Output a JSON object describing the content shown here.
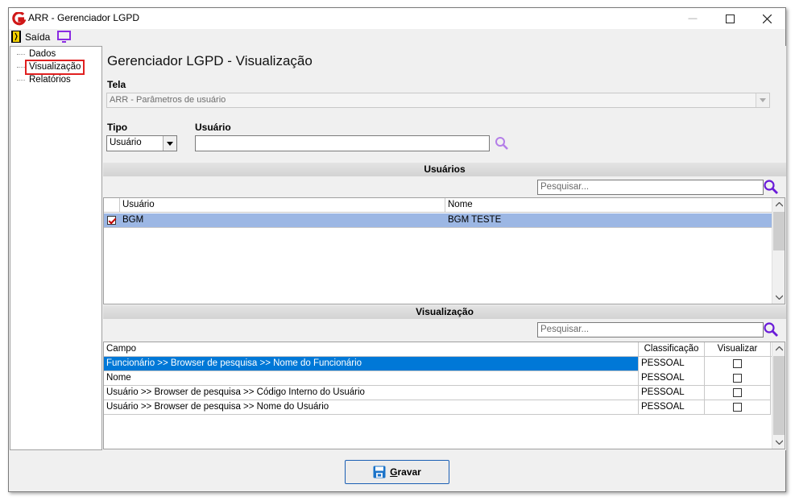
{
  "window": {
    "title": "ARR - Gerenciador LGPD",
    "minimize_glyph": "—",
    "maximize_glyph": "☐",
    "close_glyph": "✕"
  },
  "menubar": {
    "exit_label": "Saída",
    "exit_icon": "door-exit-icon",
    "screen_icon": "monitor-icon"
  },
  "sidebar": {
    "items": [
      {
        "label": "Dados"
      },
      {
        "label": "Visualização"
      },
      {
        "label": "Relatórios"
      }
    ],
    "selected_index": 1
  },
  "main": {
    "title": "Gerenciador LGPD - Visualização",
    "tela": {
      "label": "Tela",
      "value": "ARR - Parâmetros de usuário"
    },
    "tipo": {
      "label": "Tipo",
      "value": "Usuário"
    },
    "usuario": {
      "label": "Usuário",
      "value": ""
    }
  },
  "usuarios_section": {
    "title": "Usuários",
    "search_placeholder": "Pesquisar...",
    "columns": [
      "Usuário",
      "Nome"
    ],
    "rows": [
      {
        "checked": true,
        "usuario": "BGM",
        "nome": "BGM TESTE"
      }
    ]
  },
  "visualizacao_section": {
    "title": "Visualização",
    "search_placeholder": "Pesquisar...",
    "columns": [
      "Campo",
      "Classificação",
      "Visualizar"
    ],
    "rows": [
      {
        "campo": "Funcionário >> Browser de pesquisa >> Nome do Funcionário",
        "classificacao": "PESSOAL",
        "visualizar": false
      },
      {
        "campo": "Nome",
        "classificacao": "PESSOAL",
        "visualizar": false
      },
      {
        "campo": "Usuário >> Browser de pesquisa >> Código Interno do Usuário",
        "classificacao": "PESSOAL",
        "visualizar": false
      },
      {
        "campo": "Usuário >> Browser de pesquisa >> Nome do Usuário",
        "classificacao": "PESSOAL",
        "visualizar": false
      }
    ],
    "selected_row": 0
  },
  "footer": {
    "save_label_first": "G",
    "save_label_rest": "ravar",
    "save_icon": "floppy-disk-icon"
  },
  "colors": {
    "selection_blue": "#0078d7",
    "row_highlight": "#9cb7e4",
    "accent_purple": "#8a2be2",
    "exit_red": "#e02020"
  }
}
